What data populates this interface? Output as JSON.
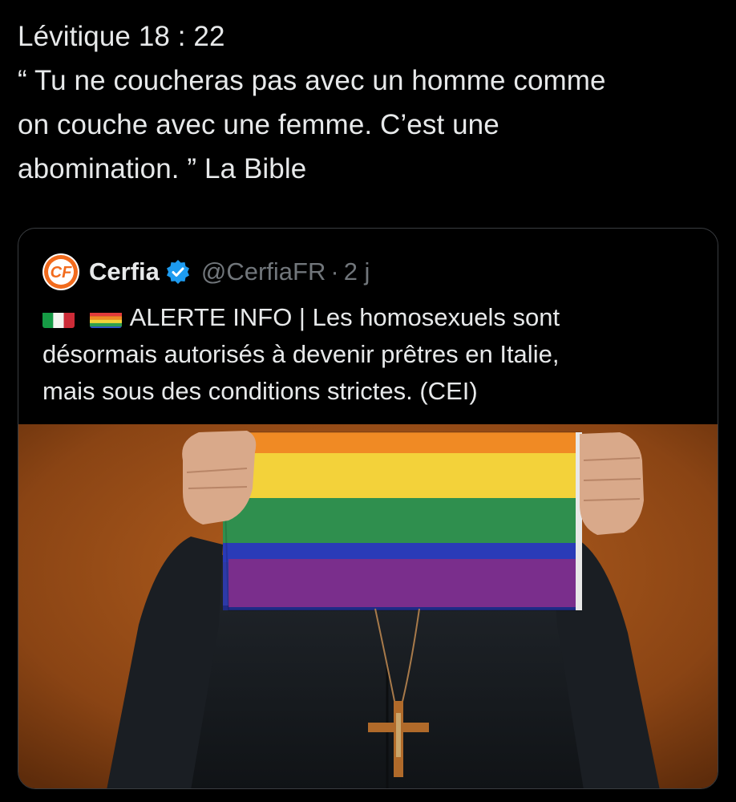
{
  "tweet": {
    "lines": [
      "Lévitique 18 : 22",
      "“ Tu ne coucheras pas avec un homme comme",
      "on couche avec une femme. C’est une",
      "abomination. ” La Bible"
    ]
  },
  "quoted_tweet": {
    "avatar_icon": "cerfia-logo-icon",
    "avatar_text": "CF",
    "display_name": "Cerfia",
    "verified_icon": "verified-badge-icon",
    "handle": "@CerfiaFR",
    "separator": "·",
    "time": "2 j",
    "flags": [
      "italy-flag-icon",
      "rainbow-flag-icon"
    ],
    "text_lines": [
      "ALERTE INFO | Les homosexuels sont",
      "désormais autorisés à devenir prêtres en Italie,",
      "mais sous des conditions strictes. (CEI)"
    ],
    "media": {
      "description_icon": "photo-priest-rainbow-flag",
      "flag_stripes": [
        "#f08a24",
        "#f3d23a",
        "#2f8f4e",
        "#2a3bb8",
        "#7a2e8c"
      ]
    }
  },
  "colors": {
    "background": "#000000",
    "text": "#e7e9ea",
    "muted": "#71767b",
    "verified": "#1d9bf0",
    "card_border": "#3a3d41",
    "logo_orange": "#f26b1d"
  }
}
